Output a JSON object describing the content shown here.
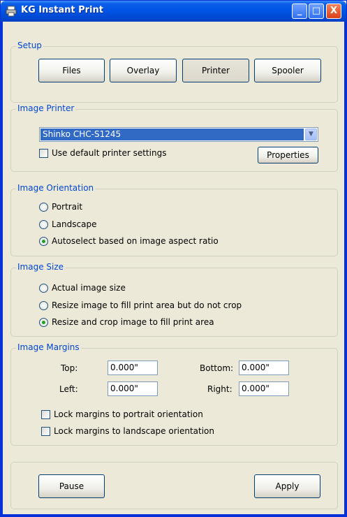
{
  "window": {
    "title": "KG Instant Print",
    "min_label": "_",
    "max_label": "□",
    "close_label": "X"
  },
  "setup": {
    "title": "Setup",
    "buttons": [
      "Files",
      "Overlay",
      "Printer",
      "Spooler"
    ],
    "selected": "Printer"
  },
  "image_printer": {
    "title": "Image Printer",
    "printer": "Shinko CHC-S1245",
    "default_settings_label": "Use default printer settings",
    "default_settings_checked": false,
    "properties_label": "Properties"
  },
  "orientation": {
    "title": "Image Orientation",
    "options": [
      "Portrait",
      "Landscape",
      "Autoselect based on image aspect ratio"
    ],
    "selected": "Autoselect based on image aspect ratio"
  },
  "size": {
    "title": "Image Size",
    "options": [
      "Actual image size",
      "Resize image to fill print area but do not crop",
      "Resize and crop image to fill print area"
    ],
    "selected": "Resize and crop image to fill print area"
  },
  "margins": {
    "title": "Image Margins",
    "top_label": "Top:",
    "top_value": "0.000\"",
    "bottom_label": "Bottom:",
    "bottom_value": "0.000\"",
    "left_label": "Left:",
    "left_value": "0.000\"",
    "right_label": "Right:",
    "right_value": "0.000\"",
    "lock_portrait_label": "Lock margins to portrait orientation",
    "lock_landscape_label": "Lock margins to landscape orientation"
  },
  "footer": {
    "pause_label": "Pause",
    "apply_label": "Apply"
  },
  "colors": {
    "title_bar": "#0054e3",
    "group_title": "#0046d5",
    "selection": "#316ac5",
    "radio_dot": "#21a121"
  }
}
